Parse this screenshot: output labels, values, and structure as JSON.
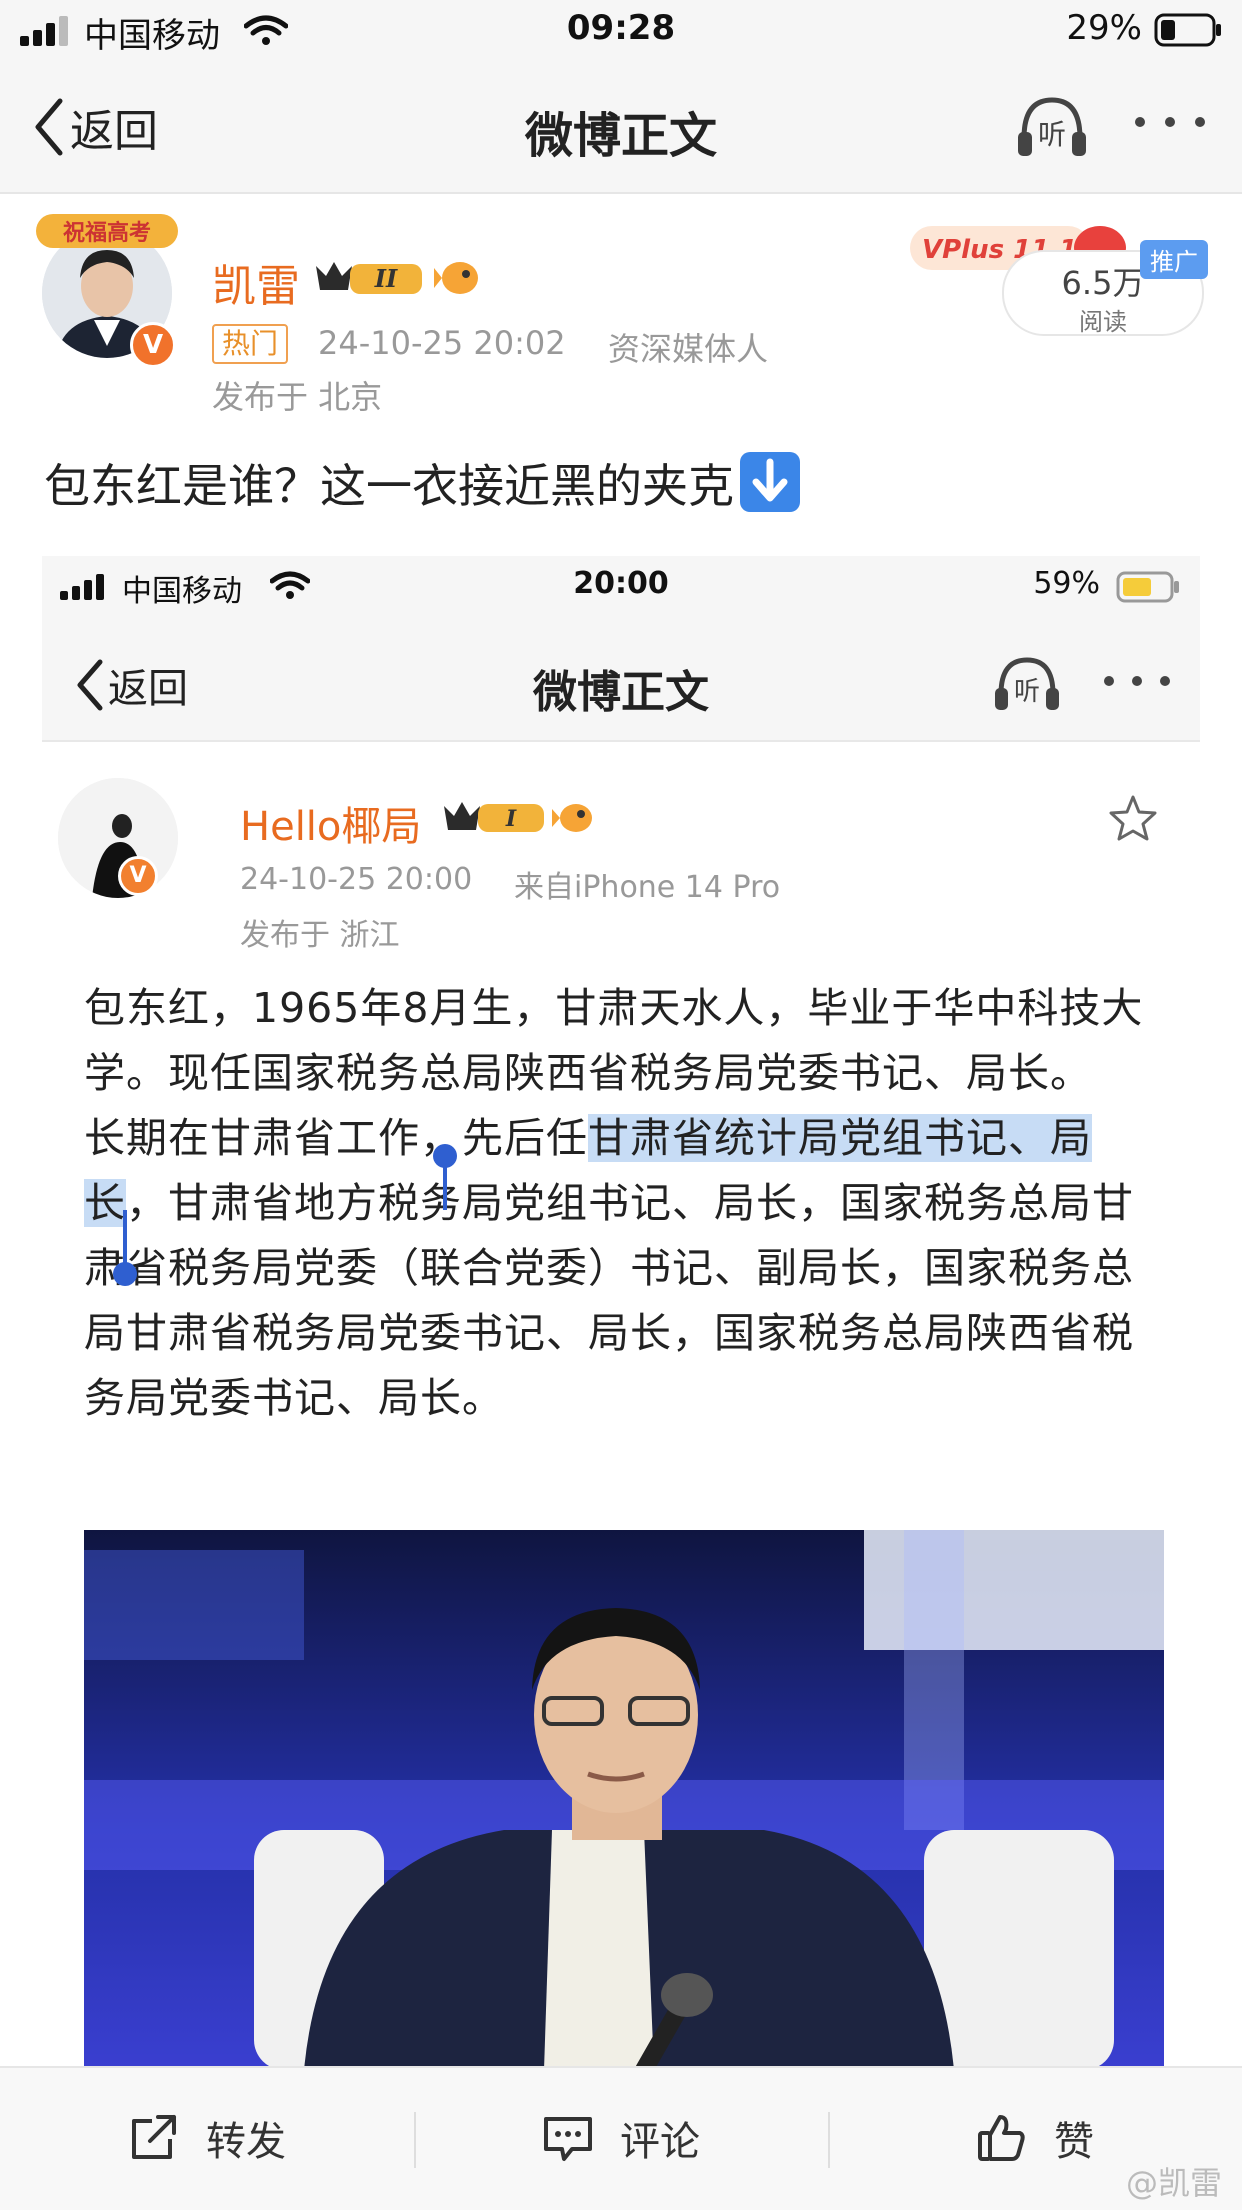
{
  "status_bar": {
    "carrier": "中国移动",
    "time": "09:28",
    "battery": "29%"
  },
  "nav": {
    "back": "返回",
    "title": "微博正文",
    "listen": "听"
  },
  "author": {
    "name": "凯雷",
    "level": "II",
    "tag": "热门",
    "time": "24-10-25 20:02",
    "source": "资深媒体人",
    "location": "发布于 北京",
    "avatar_frame_text": "祝福高考",
    "verified": "V"
  },
  "read": {
    "count": "6.5万",
    "label": "阅读",
    "promo": "推广",
    "vplus": "VPlus 11.11"
  },
  "post": {
    "text": "包东红是谁？这一衣接近黑的夹克",
    "emoji": "down-arrow-emoji"
  },
  "inner": {
    "status_bar": {
      "carrier": "中国移动",
      "time": "20:00",
      "battery": "59%"
    },
    "nav": {
      "back": "返回",
      "title": "微博正文",
      "listen": "听"
    },
    "author": {
      "name": "Hello椰局",
      "level": "I",
      "time": "24-10-25 20:00",
      "source": "来自iPhone 14 Pro",
      "location": "发布于 浙江",
      "verified": "V"
    },
    "body": {
      "p1": "包东红，1965年8月生，甘肃天水人，毕业于华中科技大学。现任国家税务总局陕西省税务局党委书记、局长。",
      "p2_a": "长期在甘肃省工作，先后任",
      "p2_hl": "甘肃省统计局党组书记、局长",
      "p2_b": "，甘肃省地方税务局党组书记、局长，国家税务总局甘肃省税务局党委（联合党委）书记、副局长，国家税务总局甘肃省税务局党委书记、局长，国家税务总局陕西省税务局党委书记、局长。"
    }
  },
  "bottom_bar": {
    "repost": "转发",
    "comment": "评论",
    "like": "赞"
  },
  "watermark": "@凯雷",
  "colors": {
    "username": "#e86b20",
    "highlight": "#c7dcf5",
    "selection": "#2f5fd0"
  }
}
